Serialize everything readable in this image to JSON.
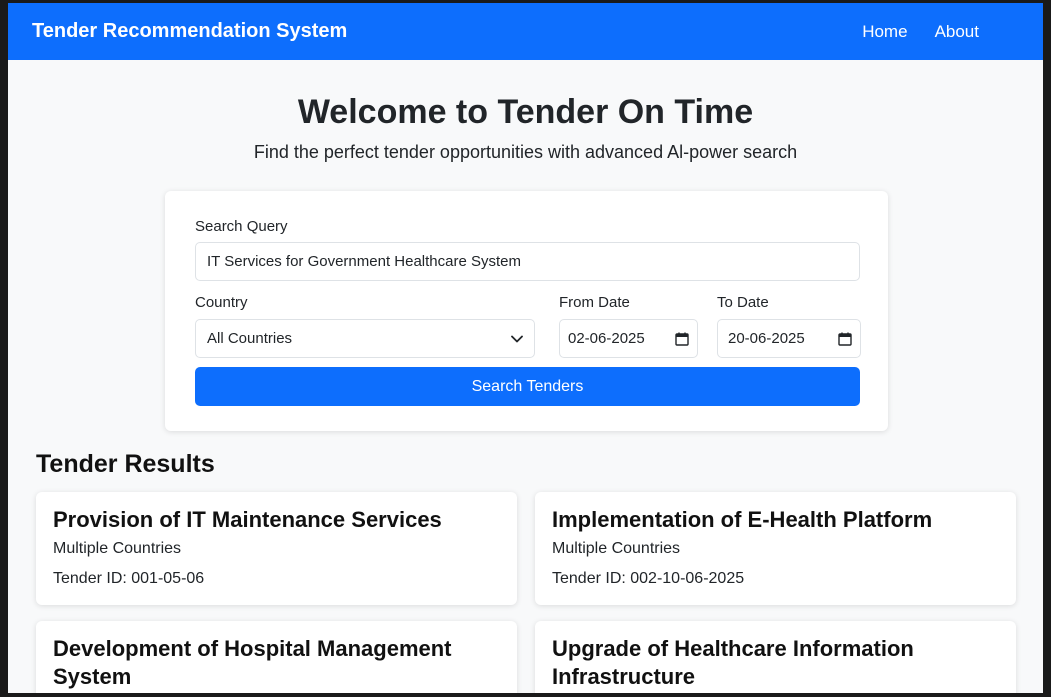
{
  "navbar": {
    "brand": "Tender Recommendation System",
    "links": [
      "Home",
      "About"
    ]
  },
  "hero": {
    "title": "Welcome to Tender On Time",
    "subtitle": "Find the perfect tender opportunities with advanced Al-power search"
  },
  "search": {
    "query_label": "Search Query",
    "query_value": "IT Services for Government Healthcare System",
    "country_label": "Country",
    "country_value": "All Countries",
    "from_label": "From Date",
    "from_value": "02-06-2025",
    "to_label": "To Date",
    "to_value": "20-06-2025",
    "button_label": "Search Tenders"
  },
  "results": {
    "title": "Tender Results",
    "items": [
      {
        "title": "Provision of IT Maintenance Services",
        "country": "Multiple Countries",
        "tender_id": "Tender ID: 001-05-06"
      },
      {
        "title": "Implementation of E-Health Platform",
        "country": "Multiple Countries",
        "tender_id": "Tender ID: 002-10-06-2025"
      },
      {
        "title": "Development of Hospital Management System",
        "country": "",
        "tender_id": ""
      },
      {
        "title": "Upgrade of Healthcare Information Infrastructure",
        "country": "",
        "tender_id": ""
      }
    ]
  },
  "colors": {
    "primary": "#0d6efd",
    "page_bg": "#f8f9fa"
  },
  "icons": [
    "chevron-down-icon",
    "calendar-icon"
  ]
}
